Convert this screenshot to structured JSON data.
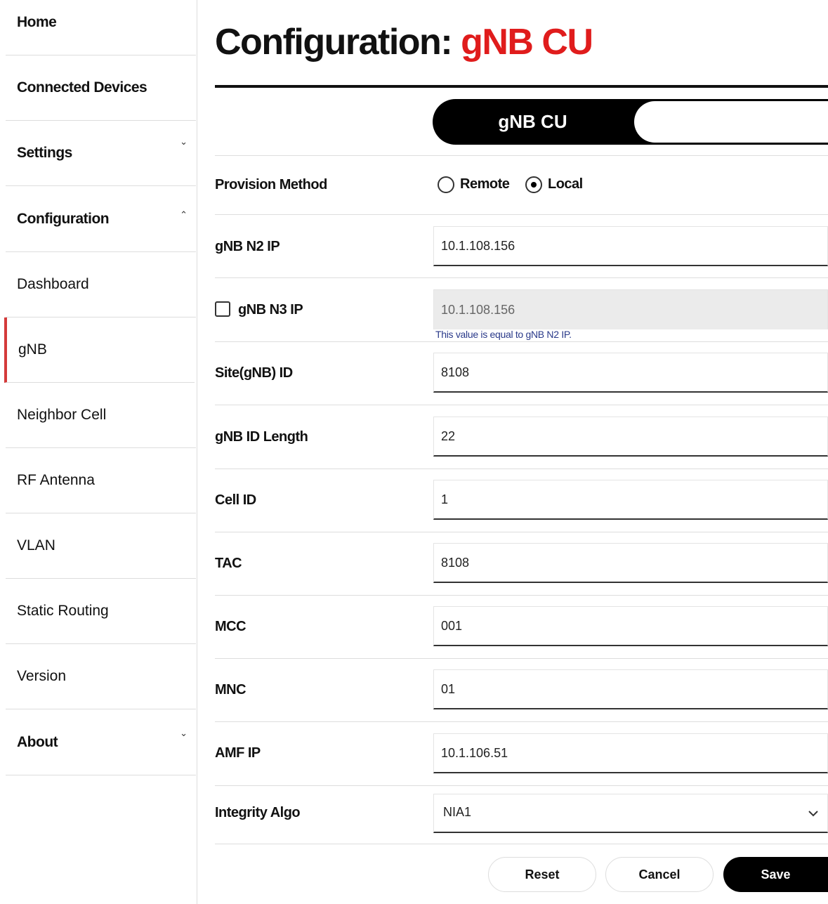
{
  "sidebar": {
    "items": [
      {
        "label": "Home"
      },
      {
        "label": "Connected Devices"
      },
      {
        "label": "Settings",
        "chevron": "⌄"
      },
      {
        "label": "Configuration",
        "chevron": "⌃"
      },
      {
        "label": "Dashboard"
      },
      {
        "label": "gNB"
      },
      {
        "label": "Neighbor Cell"
      },
      {
        "label": "RF Antenna"
      },
      {
        "label": "VLAN"
      },
      {
        "label": "Static Routing"
      },
      {
        "label": "Version"
      },
      {
        "label": "About",
        "chevron": "⌄"
      }
    ],
    "active_item": "gNB",
    "active_color": "#d43a3a"
  },
  "header": {
    "title_prefix": "Configuration:",
    "title_highlight": "gNB CU",
    "highlight_color": "#e01c1c"
  },
  "toggle": {
    "active_label": "gNB CU"
  },
  "form": {
    "provision": {
      "label": "Provision Method",
      "options": [
        "Remote",
        "Local"
      ],
      "selected": "Local"
    },
    "n2_ip": {
      "label": "gNB N2 IP",
      "value": "10.1.108.156"
    },
    "n3_ip": {
      "label": "gNB N3 IP",
      "value": "10.1.108.156",
      "checked": false,
      "hint": "This value is equal to gNB N2 IP."
    },
    "site_id": {
      "label": "Site(gNB) ID",
      "value": "8108"
    },
    "id_length": {
      "label": "gNB ID Length",
      "value": "22"
    },
    "cell_id": {
      "label": "Cell ID",
      "value": "1"
    },
    "tac": {
      "label": "TAC",
      "value": "8108"
    },
    "mcc": {
      "label": "MCC",
      "value": "001"
    },
    "mnc": {
      "label": "MNC",
      "value": "01"
    },
    "amf_ip": {
      "label": "AMF IP",
      "value": "10.1.106.51"
    },
    "integrity": {
      "label": "Integrity Algo",
      "value": "NIA1",
      "icon": "chevron-down-icon"
    }
  },
  "actions": {
    "reset": "Reset",
    "cancel": "Cancel",
    "save": "Save"
  }
}
